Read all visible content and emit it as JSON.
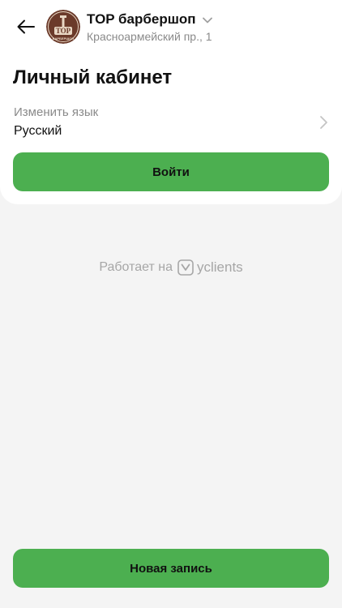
{
  "header": {
    "salon_name": "TOP барбершоп",
    "salon_address": "Красноармейский пр., 1",
    "logo_text": "ТОР",
    "logo_subtext": "БАРБЕРШОП"
  },
  "page": {
    "title": "Личный кабинет"
  },
  "language": {
    "label": "Изменить язык",
    "value": "Русский"
  },
  "buttons": {
    "login_label": "Войти",
    "new_booking_label": "Новая запись"
  },
  "footer": {
    "powered_prefix": "Работает на",
    "brand": "yclients"
  },
  "colors": {
    "accent": "#4caf50",
    "background": "#f4f4f4",
    "card": "#ffffff",
    "muted_text": "#8a8a8a",
    "logo_bg": "#6b3a2a"
  },
  "icons": {
    "back": "arrow-left-icon",
    "salon_dropdown": "chevron-down-icon",
    "language_row": "chevron-right-icon",
    "brand": "yclients-logo-icon"
  }
}
